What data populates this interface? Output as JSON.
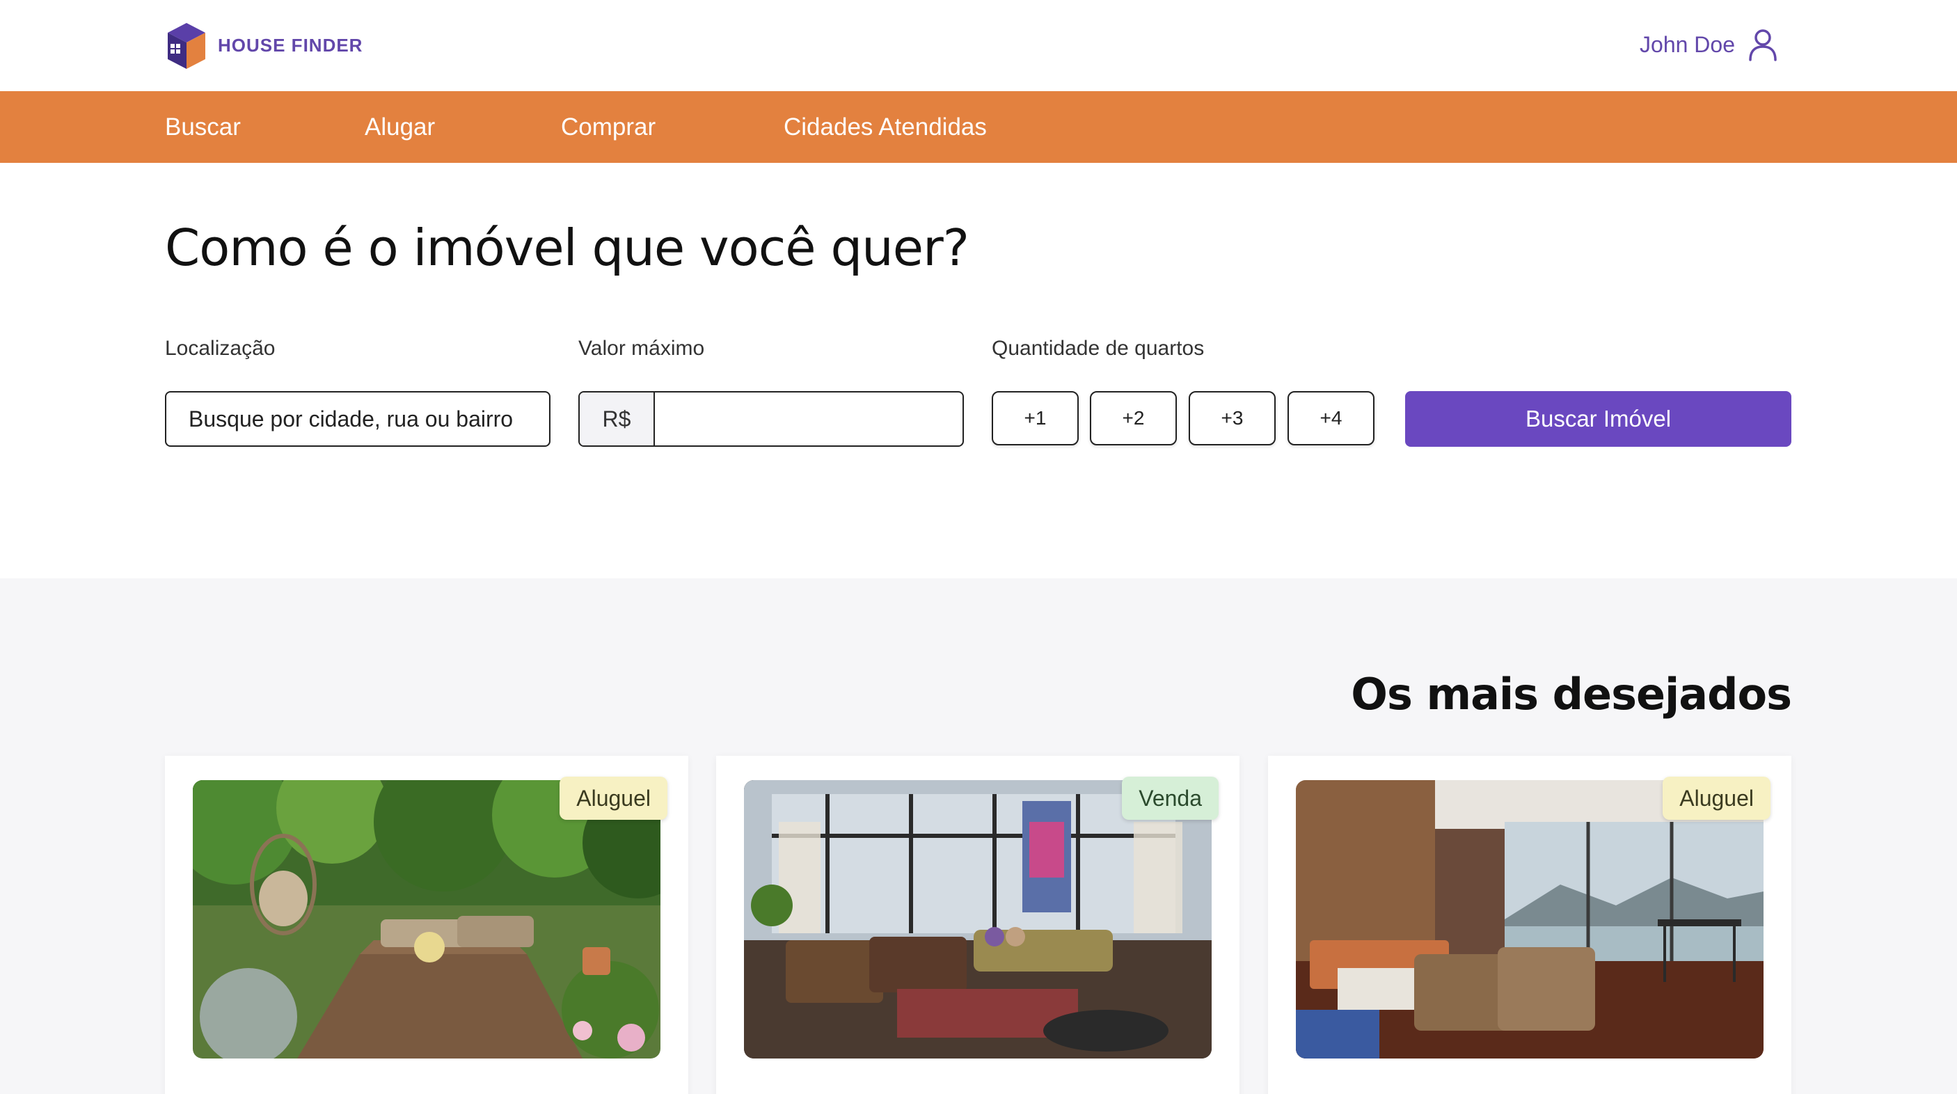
{
  "header": {
    "brand": "HOUSE FINDER",
    "user_name": "John Doe",
    "brand_color": "#6247aa",
    "brand_icon": "house-cube-icon",
    "user_icon": "user-icon"
  },
  "nav": {
    "background": "#e3813f",
    "items": [
      {
        "label": "Buscar"
      },
      {
        "label": "Alugar"
      },
      {
        "label": "Comprar"
      },
      {
        "label": "Cidades Atendidas"
      }
    ]
  },
  "search": {
    "title": "Como é o imóvel que você quer?",
    "location_label": "Localização",
    "location_placeholder": "Busque por cidade, rua ou bairro",
    "max_value_label": "Valor máximo",
    "currency": "R$",
    "max_value": "",
    "rooms_label": "Quantidade de quartos",
    "room_options": [
      "+1",
      "+2",
      "+3",
      "+4"
    ],
    "submit_label": "Buscar Imóvel",
    "accent": "#6a48c0"
  },
  "featured": {
    "title": "Os mais desejados",
    "cards": [
      {
        "badge": "Aluguel",
        "type": "rent"
      },
      {
        "badge": "Venda",
        "type": "sale"
      },
      {
        "badge": "Aluguel",
        "type": "rent"
      }
    ]
  }
}
